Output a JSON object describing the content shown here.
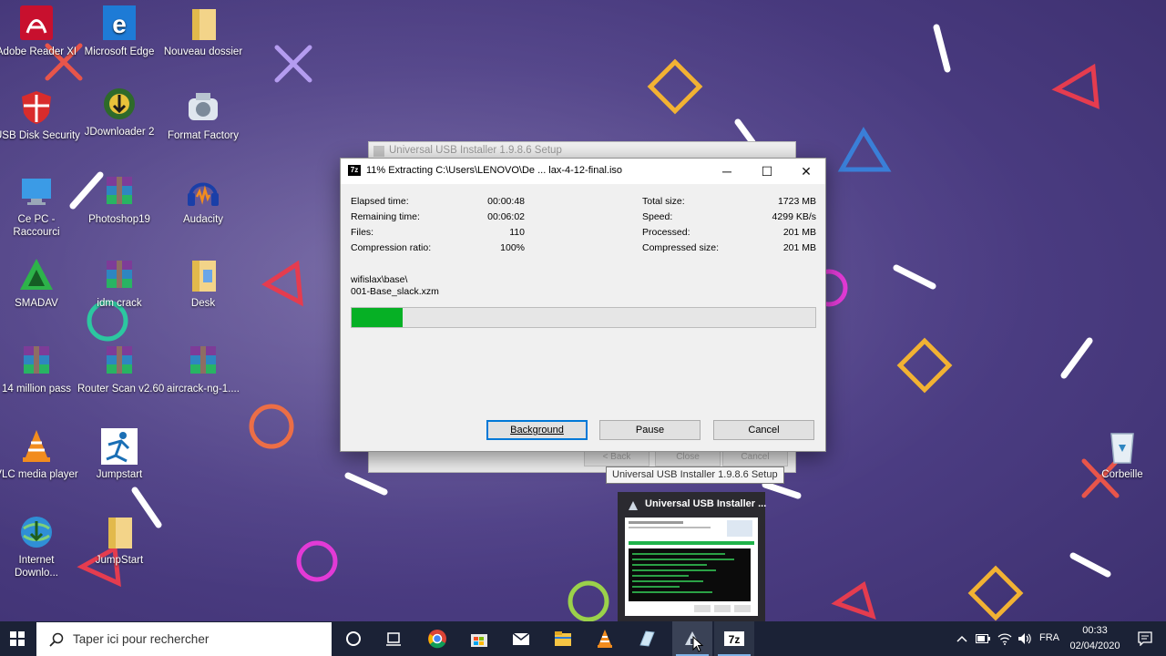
{
  "desktop": {
    "icons": [
      {
        "label": "Adobe Reader XI",
        "label2": ""
      },
      {
        "label": "Microsoft Edge",
        "label2": ""
      },
      {
        "label": "Nouveau dossier",
        "label2": ""
      },
      {
        "label": "USB Disk Security",
        "label2": ""
      },
      {
        "label": "JDownloader 2",
        "label2": ""
      },
      {
        "label": "Format Factory",
        "label2": ""
      },
      {
        "label": "Ce PC -",
        "label2": "Raccourci"
      },
      {
        "label": "Photoshop19",
        "label2": ""
      },
      {
        "label": "Audacity",
        "label2": ""
      },
      {
        "label": "SMADAV",
        "label2": ""
      },
      {
        "label": "idm crack",
        "label2": ""
      },
      {
        "label": "Desk",
        "label2": ""
      },
      {
        "label": "14 million pass",
        "label2": ""
      },
      {
        "label": "Router Scan v2.60",
        "label2": ""
      },
      {
        "label": "aircrack-ng-1....",
        "label2": ""
      },
      {
        "label": "VLC media player",
        "label2": ""
      },
      {
        "label": "Jumpstart",
        "label2": ""
      },
      {
        "label": "Internet",
        "label2": "Downlo..."
      },
      {
        "label": "JumpStart",
        "label2": ""
      },
      {
        "label": "Corbeille",
        "label2": ""
      }
    ]
  },
  "background_window": {
    "title": "Universal USB Installer 1.9.8.6 Setup",
    "buttons": [
      "< Back",
      "Close",
      "Cancel"
    ]
  },
  "dialog": {
    "title": "11% Extracting C:\\Users\\LENOVO\\De ... lax-4-12-final.iso",
    "stats_left": [
      {
        "label": "Elapsed time:",
        "value": "00:00:48"
      },
      {
        "label": "Remaining time:",
        "value": "00:06:02"
      },
      {
        "label": "Files:",
        "value": "110"
      },
      {
        "label": "Compression ratio:",
        "value": "100%"
      }
    ],
    "stats_right": [
      {
        "label": "Total size:",
        "value": "1723 MB"
      },
      {
        "label": "Speed:",
        "value": "4299 KB/s"
      },
      {
        "label": "Processed:",
        "value": "201 MB"
      },
      {
        "label": "Compressed size:",
        "value": "201 MB"
      }
    ],
    "current_path": "wifislax\\base\\",
    "current_file": "001-Base_slack.xzm",
    "progress_fraction": 0.11,
    "buttons": {
      "background": "Background",
      "pause": "Pause",
      "cancel": "Cancel"
    },
    "window_controls": {
      "minimize": "─",
      "maximize": "☐",
      "close": "✕"
    }
  },
  "tooltip": "Universal USB Installer 1.9.8.6 Setup",
  "thumbnail": {
    "title": "Universal USB Installer ..."
  },
  "taskbar": {
    "search_placeholder": "Taper ici pour rechercher",
    "language": "FRA",
    "time": "00:33",
    "date": "02/04/2020",
    "colors": {
      "bar": "#1b2236",
      "active": "#7fb2e6"
    }
  },
  "colors": {
    "progress": "#06b025",
    "focus": "#0078d7"
  }
}
